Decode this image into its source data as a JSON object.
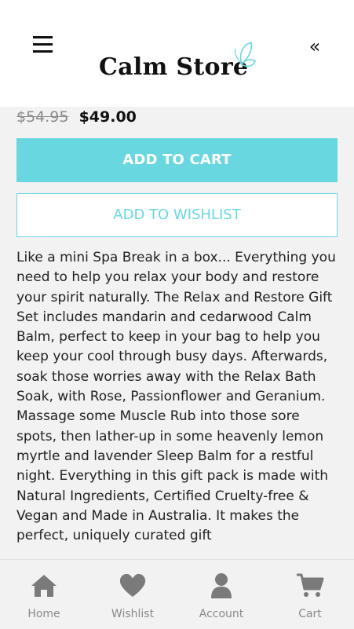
{
  "header": {
    "logo_text": "Calm Store",
    "collapse_symbol": "«",
    "icons": {
      "menu": "hamburger-menu-icon",
      "collapse": "double-chevron-left-icon",
      "logo_mark": "butterfly-icon"
    },
    "accent_color": "#68d7e0"
  },
  "product": {
    "old_price": "$54.95",
    "price": "$49.00",
    "add_to_cart_label": "ADD TO CART",
    "add_to_wishlist_label": "ADD TO WISHLIST",
    "description": "Like a mini Spa Break in a box... Everything you need to help you relax your body and restore your spirit naturally. The Relax and Restore Gift Set includes mandarin and cedarwood Calm Balm, perfect to keep in your bag to help you keep your cool through busy days. Afterwards, soak those worries away with the Relax Bath Soak, with Rose, Passionflower and Geranium. Massage some Muscle Rub into those sore spots, then lather-up in some heavenly lemon myrtle and lavender Sleep Balm for a restful night. Everything in this gift pack is made with Natural Ingredients, Certified Cruelty-free & Vegan and Made in Australia. It makes the perfect, uniquely curated gift"
  },
  "bottom_nav": {
    "items": [
      {
        "label": "Home",
        "icon": "home-icon"
      },
      {
        "label": "Wishlist",
        "icon": "heart-icon"
      },
      {
        "label": "Account",
        "icon": "user-icon"
      },
      {
        "label": "Cart",
        "icon": "cart-icon"
      }
    ],
    "icon_color": "#7a7a7a"
  }
}
